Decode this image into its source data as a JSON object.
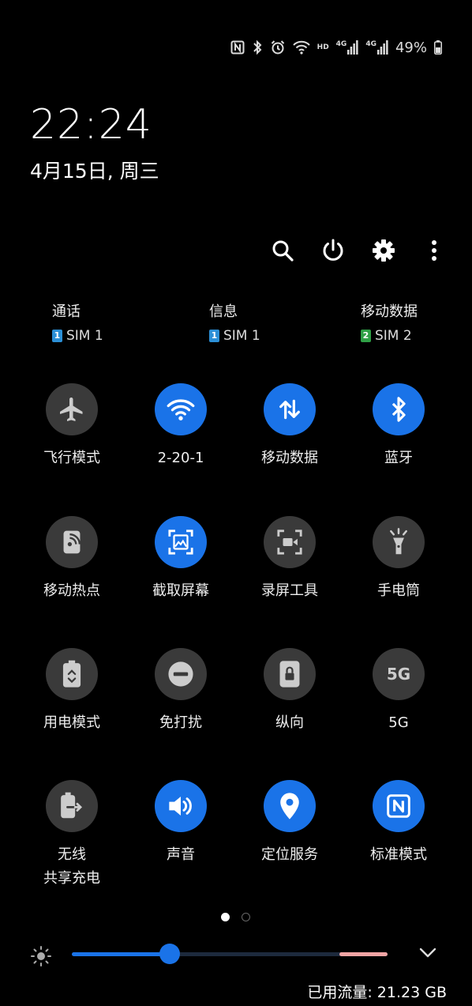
{
  "status_bar": {
    "icons": [
      "nfc-icon",
      "bluetooth-icon",
      "alarm-icon",
      "wifi-icon",
      "hd-icon",
      "signal-4g-icon",
      "signal-4g-icon",
      "battery-icon"
    ],
    "hd_label": "HD",
    "net1_label": "4G",
    "net2_label": "4G",
    "battery_percent": "49%",
    "battery_level": 0.49
  },
  "clock": {
    "time": "22:24",
    "date": "4月15日, 周三"
  },
  "top_actions": [
    "search-icon",
    "power-icon",
    "settings-icon",
    "more-icon"
  ],
  "sims": [
    {
      "label": "通话",
      "sim_num": "1",
      "sim_text": "SIM 1"
    },
    {
      "label": "信息",
      "sim_num": "1",
      "sim_text": "SIM 1"
    },
    {
      "label": "移动数据",
      "sim_num": "2",
      "sim_text": "SIM 2"
    }
  ],
  "tiles": [
    {
      "label": "飞行模式",
      "icon": "airplane-icon",
      "active": false
    },
    {
      "label": "2-20-1",
      "icon": "wifi-icon",
      "active": true
    },
    {
      "label": "移动数据",
      "icon": "mobile-data-icon",
      "active": true
    },
    {
      "label": "蓝牙",
      "icon": "bluetooth-icon",
      "active": true
    },
    {
      "label": "移动热点",
      "icon": "hotspot-icon",
      "active": false
    },
    {
      "label": "截取屏幕",
      "icon": "screenshot-icon",
      "active": true
    },
    {
      "label": "录屏工具",
      "icon": "screen-recorder-icon",
      "active": false
    },
    {
      "label": "手电筒",
      "icon": "flashlight-icon",
      "active": false
    },
    {
      "label": "用电模式",
      "icon": "power-mode-icon",
      "active": false
    },
    {
      "label": "免打扰",
      "icon": "do-not-disturb-icon",
      "active": false
    },
    {
      "label": "纵向",
      "icon": "portrait-lock-icon",
      "active": false
    },
    {
      "label": "5G",
      "icon": "5g-icon",
      "icon_text": "5G",
      "active": false
    },
    {
      "label": "无线\n共享充电",
      "icon": "wireless-powershare-icon",
      "active": false
    },
    {
      "label": "声音",
      "icon": "sound-icon",
      "active": true
    },
    {
      "label": "定位服务",
      "icon": "location-icon",
      "active": true
    },
    {
      "label": "标准模式",
      "icon": "nfc-icon",
      "active": true
    }
  ],
  "pagination": {
    "current": 1,
    "total": 2
  },
  "brightness": {
    "level": 0.31,
    "icon": "brightness-icon",
    "expand_icon": "chevron-down-icon"
  },
  "data_usage": "已用流量: 21.23 GB",
  "colors": {
    "active": "#1a73e8",
    "inactive": "#3a3a3a",
    "background": "#000000"
  }
}
